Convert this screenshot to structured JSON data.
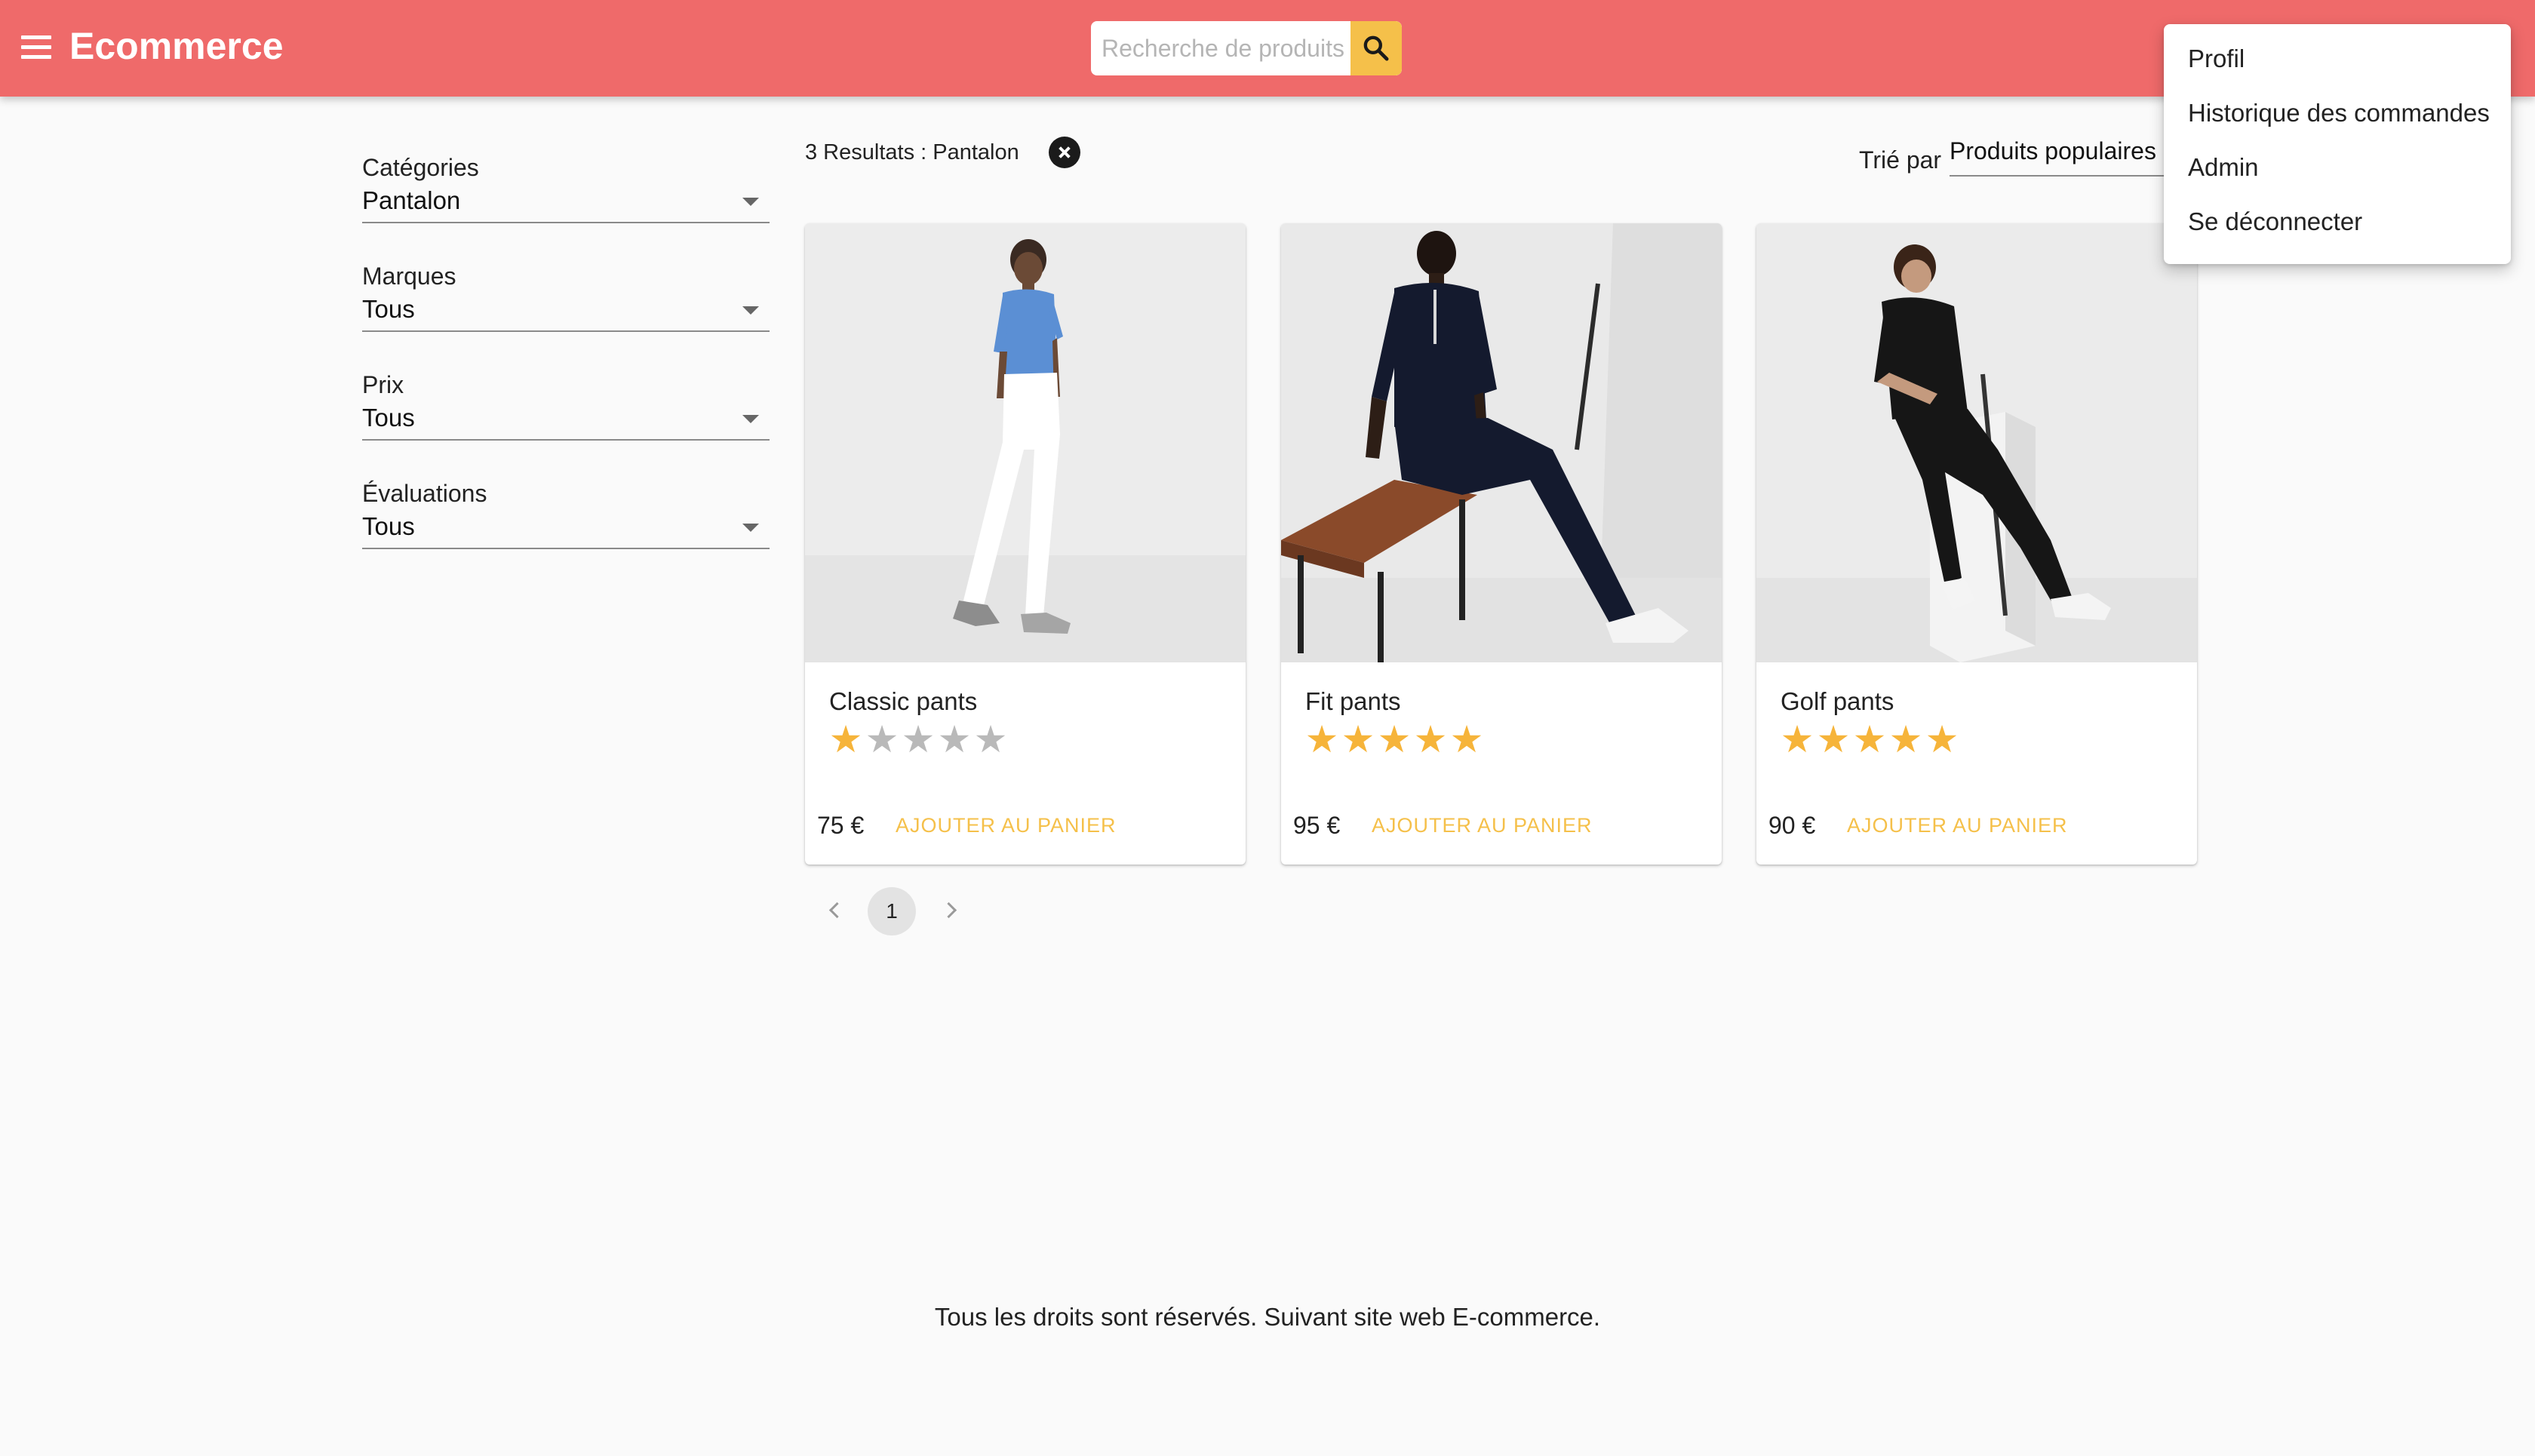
{
  "header": {
    "title": "Ecommerce",
    "search_placeholder": "Recherche de produits",
    "search_value": ""
  },
  "filters": [
    {
      "label": "Catégories",
      "value": "Pantalon"
    },
    {
      "label": "Marques",
      "value": "Tous"
    },
    {
      "label": "Prix",
      "value": "Tous"
    },
    {
      "label": "Évaluations",
      "value": "Tous"
    }
  ],
  "results": {
    "summary": "3 Resultats : Pantalon",
    "sort_label": "Trié par",
    "sort_value": "Produits populaires"
  },
  "products": [
    {
      "name": "Classic pants",
      "rating": 1,
      "max_rating": 5,
      "price": "75 €",
      "action": "AJOUTER AU PANIER",
      "image": "model-white-pants-photo"
    },
    {
      "name": "Fit pants",
      "rating": 5,
      "max_rating": 5,
      "price": "95 €",
      "action": "AJOUTER AU PANIER",
      "image": "model-navy-pants-photo"
    },
    {
      "name": "Golf pants",
      "rating": 5,
      "max_rating": 5,
      "price": "90 €",
      "action": "AJOUTER AU PANIER",
      "image": "model-black-golf-pants-photo"
    }
  ],
  "pagination": {
    "current_page": "1"
  },
  "footer": {
    "text": "Tous les droits sont réservés. Suivant site web E-commerce."
  },
  "user_menu": {
    "items": [
      "Profil",
      "Historique des commandes",
      "Admin",
      "Se déconnecter"
    ]
  },
  "colors": {
    "header_bg": "#ef6a6a",
    "accent": "#f5c04a",
    "star_on": "#f6b43a",
    "star_off": "#b9b9b9",
    "page_bg": "#fafafa"
  }
}
